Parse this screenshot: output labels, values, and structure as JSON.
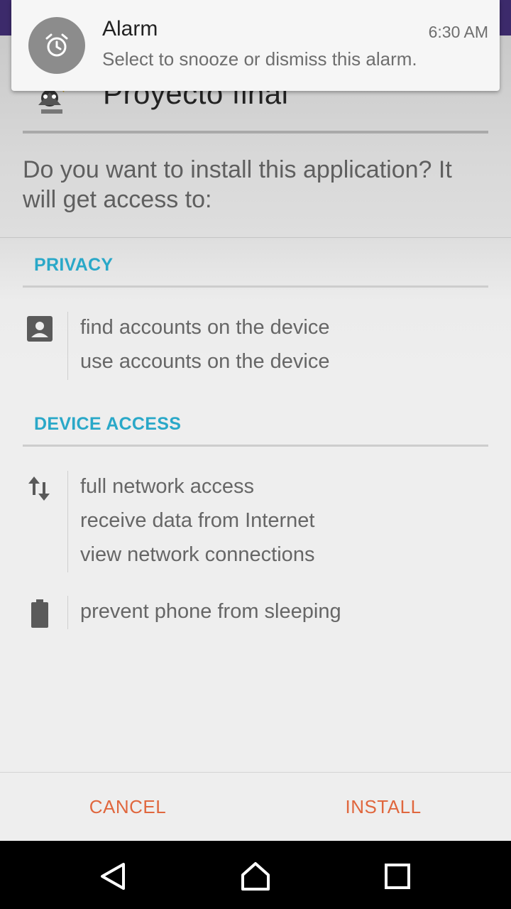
{
  "notification": {
    "title": "Alarm",
    "time": "6:30 AM",
    "text": "Select to snooze or dismiss this alarm.",
    "icon": "alarm-clock-icon"
  },
  "app": {
    "name": "Proyecto final",
    "icon": "app-logo-icon"
  },
  "install_question": "Do you want to install this application? It will get access to:",
  "sections": {
    "privacy": {
      "title": "PRIVACY",
      "groups": [
        {
          "icon": "account-icon",
          "items": [
            "find accounts on the device",
            "use accounts on the device"
          ]
        }
      ]
    },
    "device_access": {
      "title": "DEVICE ACCESS",
      "groups": [
        {
          "icon": "network-arrows-icon",
          "items": [
            "full network access",
            "receive data from Internet",
            "view network connections"
          ]
        },
        {
          "icon": "battery-icon",
          "items": [
            "prevent phone from sleeping"
          ]
        }
      ]
    }
  },
  "buttons": {
    "cancel": "CANCEL",
    "install": "INSTALL"
  },
  "nav": {
    "back": "back-icon",
    "home": "home-icon",
    "recents": "recents-icon"
  },
  "colors": {
    "status_bar": "#3c2a6b",
    "section_title": "#2aa8c8",
    "button_text": "#e0673e"
  }
}
